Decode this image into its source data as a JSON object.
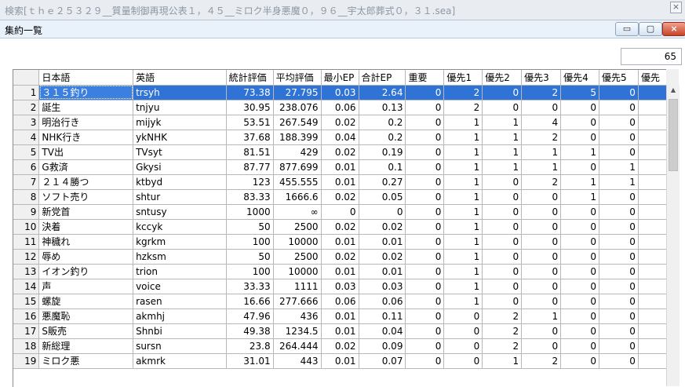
{
  "app": {
    "title": "検索[ｔｈｅ２５３２９__質量制御再現公表１，４５__ミロク半身悪魔０，９６__宇太郎葬式０，３１.sea]",
    "close_glyph": "×"
  },
  "window": {
    "title": "集約一覧",
    "min_glyph": "▭",
    "max_glyph": "▢",
    "close_glyph": "×"
  },
  "count": "65",
  "columns": [
    "日本語",
    "英語",
    "統計評価",
    "平均評価",
    "最小EP",
    "合計EP",
    "重要",
    "優先1",
    "優先2",
    "優先3",
    "優先4",
    "優先5",
    "優先"
  ],
  "rows": [
    {
      "n": "1",
      "c": [
        "３１５釣り",
        "trsyh",
        "73.38",
        "27.795",
        "0.03",
        "2.64",
        "0",
        "2",
        "0",
        "2",
        "5",
        "0",
        ""
      ]
    },
    {
      "n": "2",
      "c": [
        "誕生",
        "tnjyu",
        "30.95",
        "238.076",
        "0.06",
        "0.13",
        "0",
        "2",
        "0",
        "0",
        "0",
        "0",
        ""
      ]
    },
    {
      "n": "3",
      "c": [
        "明治行き",
        "mijyk",
        "53.51",
        "267.549",
        "0.02",
        "0.2",
        "0",
        "1",
        "1",
        "4",
        "0",
        "0",
        ""
      ]
    },
    {
      "n": "4",
      "c": [
        "NHK行き",
        "ykNHK",
        "37.68",
        "188.399",
        "0.04",
        "0.2",
        "0",
        "1",
        "1",
        "2",
        "0",
        "0",
        ""
      ]
    },
    {
      "n": "5",
      "c": [
        "TV出",
        "TVsyt",
        "81.51",
        "429",
        "0.02",
        "0.19",
        "0",
        "1",
        "1",
        "1",
        "1",
        "0",
        ""
      ]
    },
    {
      "n": "6",
      "c": [
        "G救済",
        "Gkysi",
        "87.77",
        "877.699",
        "0.01",
        "0.1",
        "0",
        "1",
        "1",
        "1",
        "0",
        "1",
        ""
      ]
    },
    {
      "n": "7",
      "c": [
        "２１４勝つ",
        "ktbyd",
        "123",
        "455.555",
        "0.01",
        "0.27",
        "0",
        "1",
        "0",
        "2",
        "1",
        "1",
        ""
      ]
    },
    {
      "n": "8",
      "c": [
        "ソフト売り",
        "shtur",
        "83.33",
        "1666.6",
        "0.02",
        "0.05",
        "0",
        "1",
        "0",
        "0",
        "1",
        "0",
        ""
      ]
    },
    {
      "n": "9",
      "c": [
        "新党首",
        "sntusy",
        "1000",
        "∞",
        "0",
        "0",
        "0",
        "1",
        "0",
        "0",
        "0",
        "0",
        ""
      ]
    },
    {
      "n": "10",
      "c": [
        "決着",
        "kccyk",
        "50",
        "2500",
        "0.02",
        "0.02",
        "0",
        "1",
        "0",
        "0",
        "0",
        "0",
        ""
      ]
    },
    {
      "n": "11",
      "c": [
        "神穢れ",
        "kgrkm",
        "100",
        "10000",
        "0.01",
        "0.01",
        "0",
        "1",
        "0",
        "0",
        "0",
        "0",
        ""
      ]
    },
    {
      "n": "12",
      "c": [
        "辱め",
        "hzksm",
        "50",
        "2500",
        "0.02",
        "0.02",
        "0",
        "1",
        "0",
        "0",
        "0",
        "0",
        ""
      ]
    },
    {
      "n": "13",
      "c": [
        "イオン釣り",
        "trion",
        "100",
        "10000",
        "0.01",
        "0.01",
        "0",
        "1",
        "0",
        "0",
        "0",
        "0",
        ""
      ]
    },
    {
      "n": "14",
      "c": [
        "声",
        "voice",
        "33.33",
        "1111",
        "0.03",
        "0.03",
        "0",
        "1",
        "0",
        "0",
        "0",
        "0",
        ""
      ]
    },
    {
      "n": "15",
      "c": [
        "螺旋",
        "rasen",
        "16.66",
        "277.666",
        "0.06",
        "0.06",
        "0",
        "1",
        "0",
        "0",
        "0",
        "0",
        ""
      ]
    },
    {
      "n": "16",
      "c": [
        "悪魔恥",
        "akmhj",
        "47.96",
        "436",
        "0.01",
        "0.11",
        "0",
        "0",
        "2",
        "1",
        "0",
        "0",
        ""
      ]
    },
    {
      "n": "17",
      "c": [
        "S販売",
        "Shnbi",
        "49.38",
        "1234.5",
        "0.01",
        "0.04",
        "0",
        "0",
        "2",
        "0",
        "0",
        "0",
        ""
      ]
    },
    {
      "n": "18",
      "c": [
        "新総理",
        "sursn",
        "23.8",
        "264.444",
        "0.02",
        "0.09",
        "0",
        "0",
        "2",
        "0",
        "0",
        "0",
        ""
      ]
    },
    {
      "n": "19",
      "c": [
        "ミロク悪",
        "akmrk",
        "31.01",
        "443",
        "0.01",
        "0.07",
        "0",
        "0",
        "1",
        "2",
        "0",
        "0",
        ""
      ]
    }
  ]
}
